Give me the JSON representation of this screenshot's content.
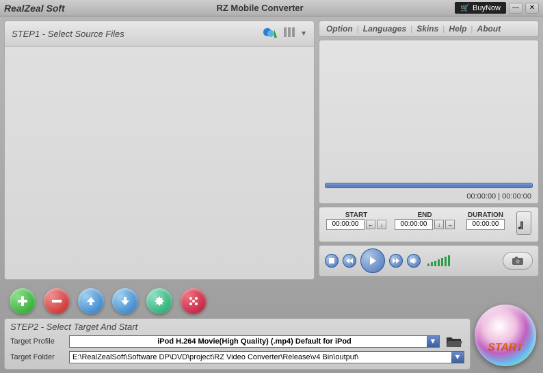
{
  "titlebar": {
    "brand": "RealZeal Soft",
    "app": "RZ Mobile Converter",
    "buynow": "BuyNow"
  },
  "menu": {
    "option": "Option",
    "languages": "Languages",
    "skins": "Skins",
    "help": "Help",
    "about": "About"
  },
  "step1": {
    "title": "STEP1 - Select Source Files"
  },
  "preview": {
    "time_left": "00:00:00",
    "time_right": "00:00:00"
  },
  "trim": {
    "start_label": "START",
    "end_label": "END",
    "duration_label": "DURATION",
    "start": "00:00:00",
    "end": "00:00:00",
    "duration": "00:00:00"
  },
  "step2": {
    "title": "STEP2 - Select Target And Start",
    "profile_label": "Target Profile",
    "profile_value": "iPod H.264 Movie(High Quality) (.mp4) Default for iPod",
    "folder_label": "Target Folder",
    "folder_value": "E:\\RealZealSoft\\Software DP\\DVD\\project\\RZ Video Converter\\Release\\v4 Bin\\output\\"
  },
  "start": {
    "label": "START"
  }
}
